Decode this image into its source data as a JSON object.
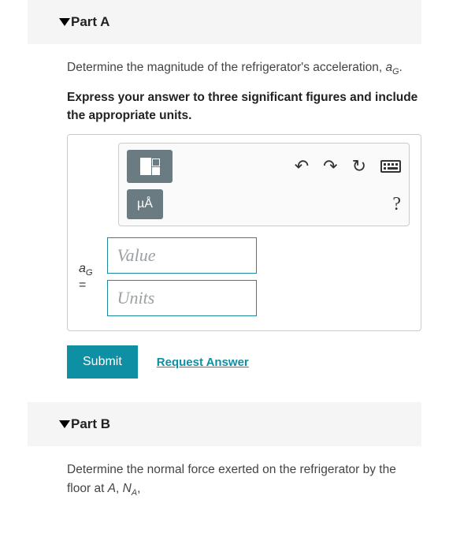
{
  "partA": {
    "title": "Part A",
    "prompt_pre": "Determine the magnitude of the refrigerator's acceleration, ",
    "prompt_var": "a",
    "prompt_sub": "G",
    "prompt_post": ".",
    "instruction": "Express your answer to three significant figures and include the appropriate units.",
    "toolbar": {
      "template_icon": "fraction-template-icon",
      "units_btn": "µÅ",
      "undo_icon": "↶",
      "redo_icon": "↷",
      "reset_icon": "↻",
      "keyboard_icon": "keyboard-icon",
      "help_icon": "?"
    },
    "var_label": "a",
    "var_sub": "G",
    "equals": "=",
    "value_placeholder": "Value",
    "units_placeholder": "Units",
    "submit": "Submit",
    "request": "Request Answer"
  },
  "partB": {
    "title": "Part B",
    "prompt_pre": "Determine the normal force exerted on the refrigerator by the floor at ",
    "prompt_mid1": "A",
    "prompt_mid2": ", ",
    "prompt_var": "N",
    "prompt_sub": "A",
    "prompt_post": ","
  }
}
